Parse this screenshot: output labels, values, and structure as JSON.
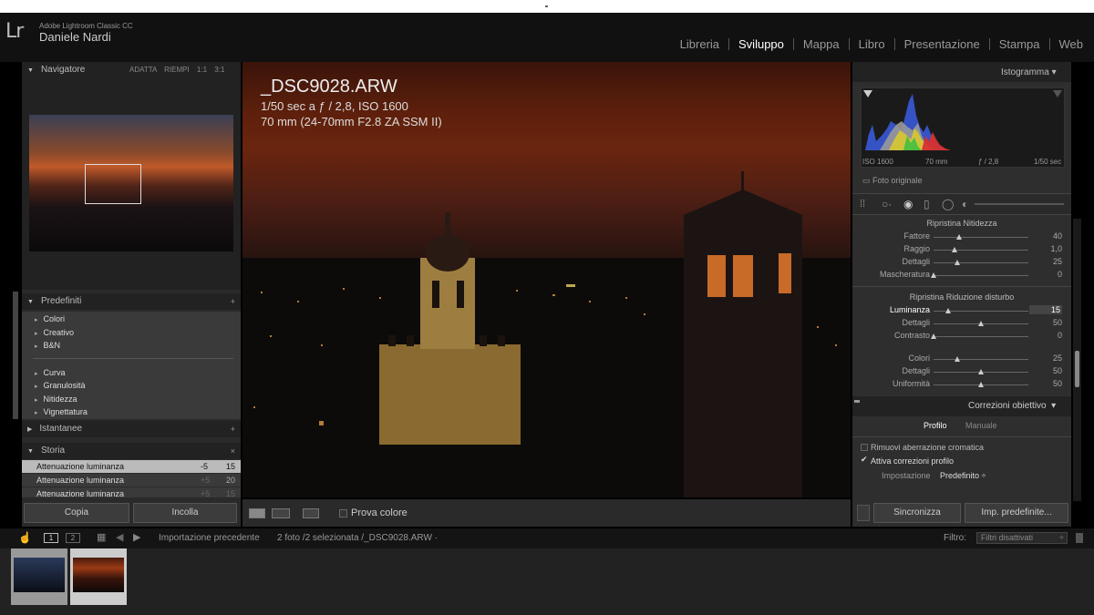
{
  "app": {
    "name": "Adobe Lightroom Classic CC",
    "user": "Daniele Nardi",
    "logo": "Lr"
  },
  "modules": [
    {
      "label": "Libreria"
    },
    {
      "label": "Sviluppo",
      "active": true
    },
    {
      "label": "Mappa"
    },
    {
      "label": "Libro"
    },
    {
      "label": "Presentazione"
    },
    {
      "label": "Stampa"
    },
    {
      "label": "Web"
    }
  ],
  "navigator": {
    "title": "Navigatore",
    "options": "ADATTA  RIEMPI  1:1  3:1"
  },
  "presets": {
    "title": "Predefiniti",
    "groups1": [
      "Colori",
      "Creativo",
      "B&N"
    ],
    "groups2": [
      "Curva",
      "Granulosità",
      "Nitidezza",
      "Vignettatura"
    ]
  },
  "snapshots": {
    "title": "Istantanee"
  },
  "history": {
    "title": "Storia",
    "rows": [
      {
        "label": "Attenuazione luminanza",
        "a": "-5",
        "b": "15"
      },
      {
        "label": "Attenuazione luminanza",
        "a": "+5",
        "b": "20"
      },
      {
        "label": "Attenuazione luminanza",
        "a": "+5",
        "b": "15"
      }
    ]
  },
  "left_buttons": {
    "copy": "Copia",
    "paste": "Incolla"
  },
  "photo": {
    "filename": "_DSC9028.ARW",
    "exif1": "1/50 sec a ƒ / 2,8, ISO 1600",
    "exif2": "70 mm (24-70mm F2.8 ZA SSM II)"
  },
  "toolbar": {
    "prova_colore": "Prova colore"
  },
  "histogram": {
    "title": "Istogramma",
    "iso": "ISO 1600",
    "focal": "70 mm",
    "aperture": "ƒ / 2,8",
    "shutter": "1/50 sec",
    "original": "Foto originale"
  },
  "sharpening": {
    "title": "Ripristina Nitidezza",
    "sliders": [
      {
        "label": "Fattore",
        "value": "40",
        "pos": 0.27
      },
      {
        "label": "Raggio",
        "value": "1,0",
        "pos": 0.22
      },
      {
        "label": "Dettagli",
        "value": "25",
        "pos": 0.25
      },
      {
        "label": "Mascheratura",
        "value": "0",
        "pos": 0.0
      }
    ]
  },
  "noise": {
    "title": "Ripristina Riduzione disturbo",
    "lum_sliders": [
      {
        "label": "Luminanza",
        "value": "15",
        "pos": 0.15
      },
      {
        "label": "Dettagli",
        "value": "50",
        "pos": 0.5
      },
      {
        "label": "Contrasto",
        "value": "0",
        "pos": 0.0
      }
    ],
    "color_sliders": [
      {
        "label": "Colori",
        "value": "25",
        "pos": 0.25
      },
      {
        "label": "Dettagli",
        "value": "50",
        "pos": 0.5
      },
      {
        "label": "Uniformità",
        "value": "50",
        "pos": 0.5
      }
    ]
  },
  "lens": {
    "title": "Correzioni obiettivo",
    "tab_profile": "Profilo",
    "tab_manual": "Manuale",
    "remove_ca": "Rimuovi aberrazione cromatica",
    "enable_profile": "Attiva correzioni profilo",
    "setting_label": "Impostazione",
    "setting_value": "Predefinito ÷"
  },
  "right_buttons": {
    "sync": "Sincronizza",
    "defaults": "Imp. predefinite..."
  },
  "bottombar": {
    "page1": "1",
    "page2": "2",
    "source": "Importazione precedente",
    "selection": "2 foto /2 selezionata /_DSC9028.ARW ·",
    "filter_label": "Filtro:",
    "filter_value": "Filtri disattivati"
  }
}
